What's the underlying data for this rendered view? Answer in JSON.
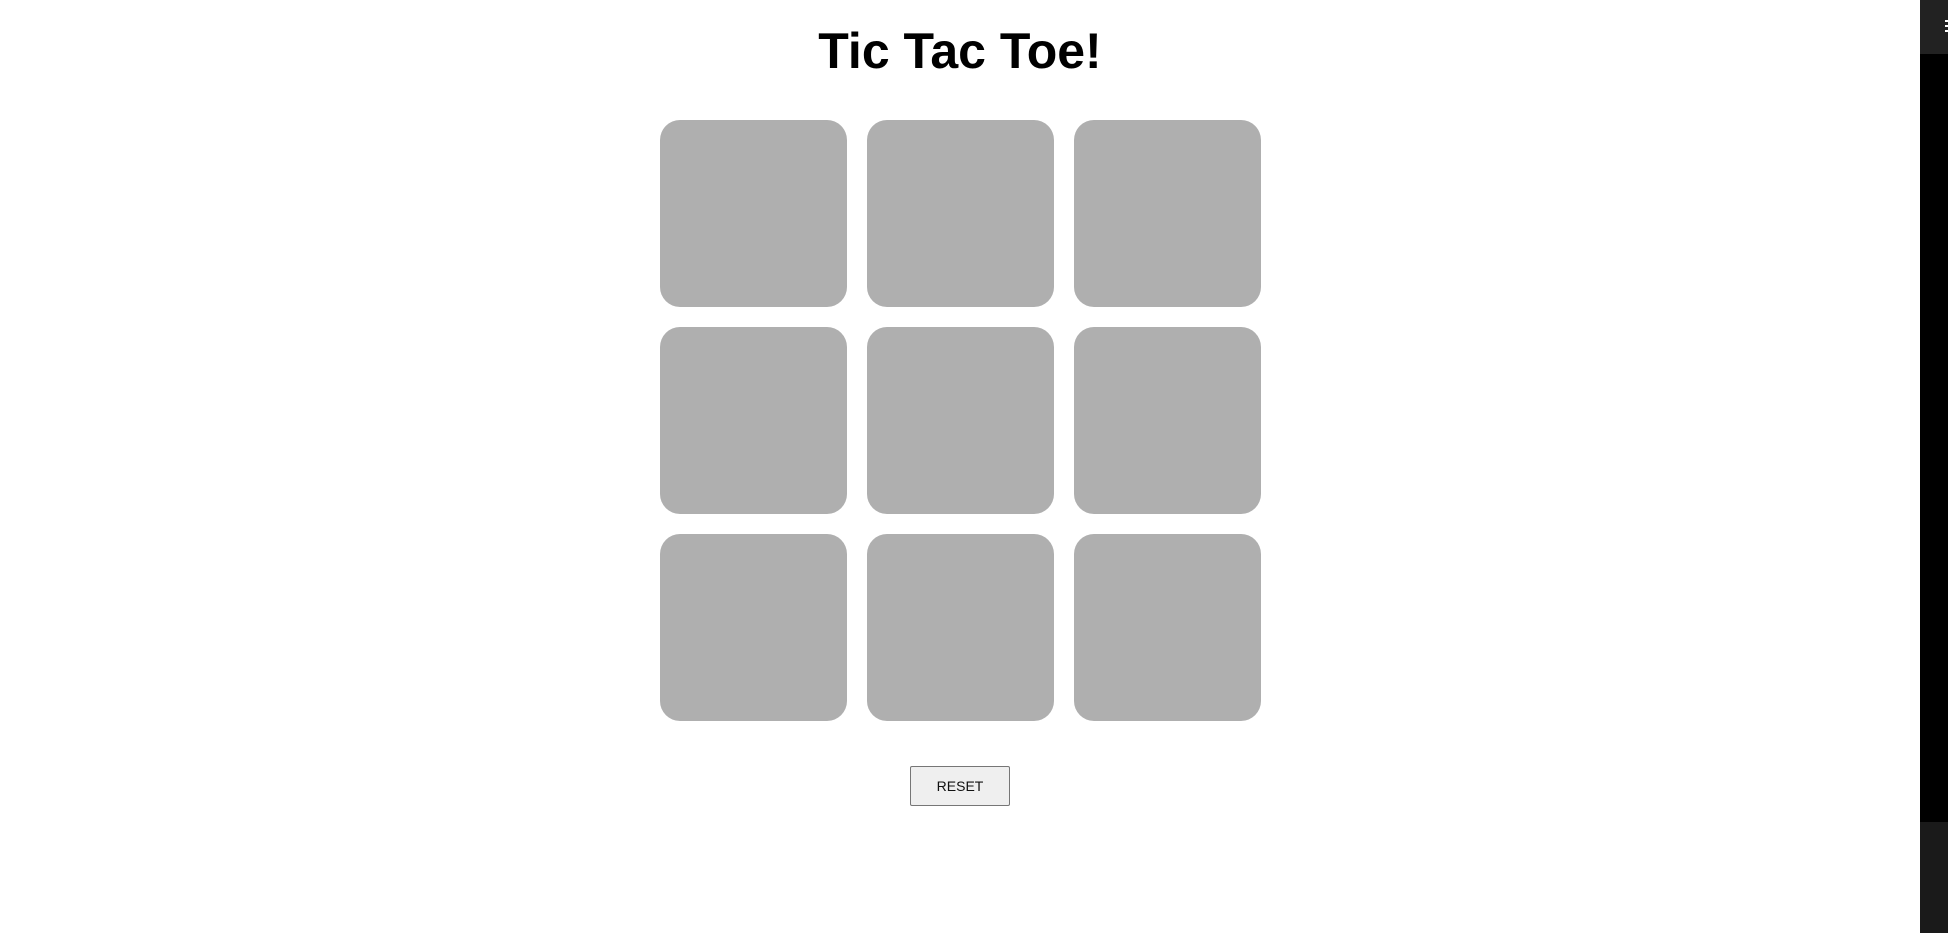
{
  "title": "Tic Tac Toe!",
  "board": {
    "cells": [
      "",
      "",
      "",
      "",
      "",
      "",
      "",
      "",
      ""
    ]
  },
  "reset_label": "RESET",
  "colors": {
    "cell": "#afafaf",
    "background": "#ffffff"
  }
}
